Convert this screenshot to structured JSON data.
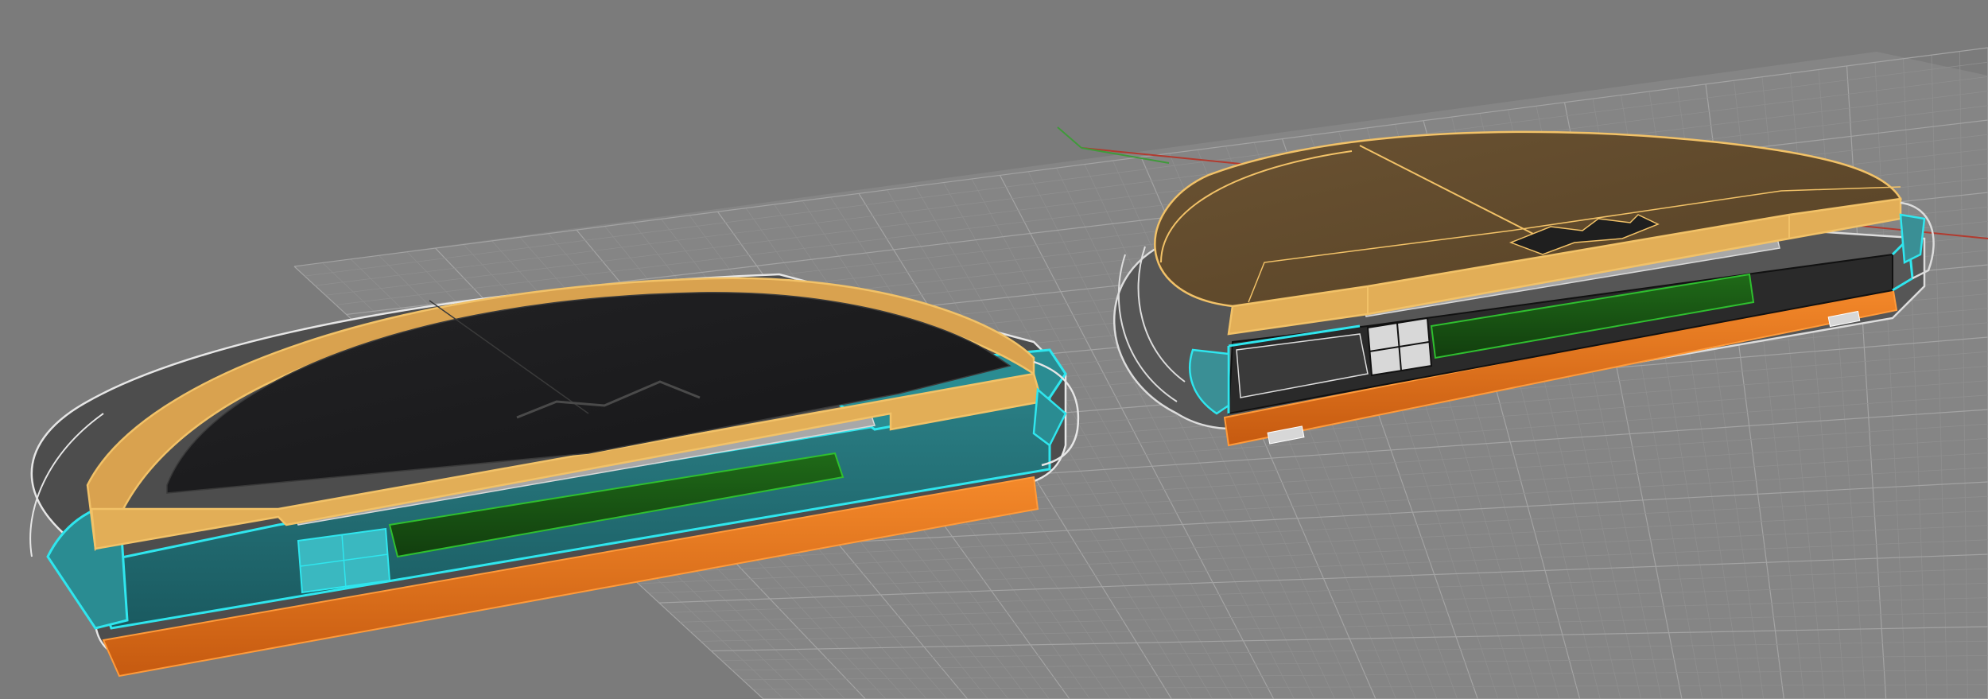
{
  "viewport": {
    "name": "perspective-viewport",
    "background_color": "#7b7b7b",
    "grid": {
      "visible": true,
      "minor_line_color": "#8f8f8f",
      "major_line_color": "#a3a3a3",
      "plane_color": "#878787",
      "x_axis_color": "#b23a2e",
      "y_axis_color": "#3f9a3a"
    }
  },
  "palette": {
    "cover_top": "#5f4a2c",
    "cover_rim": "#f2c268",
    "cover_rim_side": "#d9a24f",
    "cover_dark_face": "#1c1c1e",
    "shell_cyan": "#2fe6ee",
    "shell_cyan_fill": "#1f6a70",
    "base_orange": "#f07d1e",
    "base_orange_side": "#c85d0e",
    "pcb_green": "#1c5a16",
    "pcb_edge": "#2fbf2f",
    "led_strip": "#39ff39",
    "rail_grey": "#a8a8a8",
    "outline_white": "#e8e8e8",
    "body_grey": "#4a4a4a"
  },
  "objects": [
    {
      "name": "device-assembly-section-view",
      "kind": "3d-model"
    },
    {
      "name": "device-assembly-rendered-view",
      "kind": "3d-model"
    }
  ]
}
